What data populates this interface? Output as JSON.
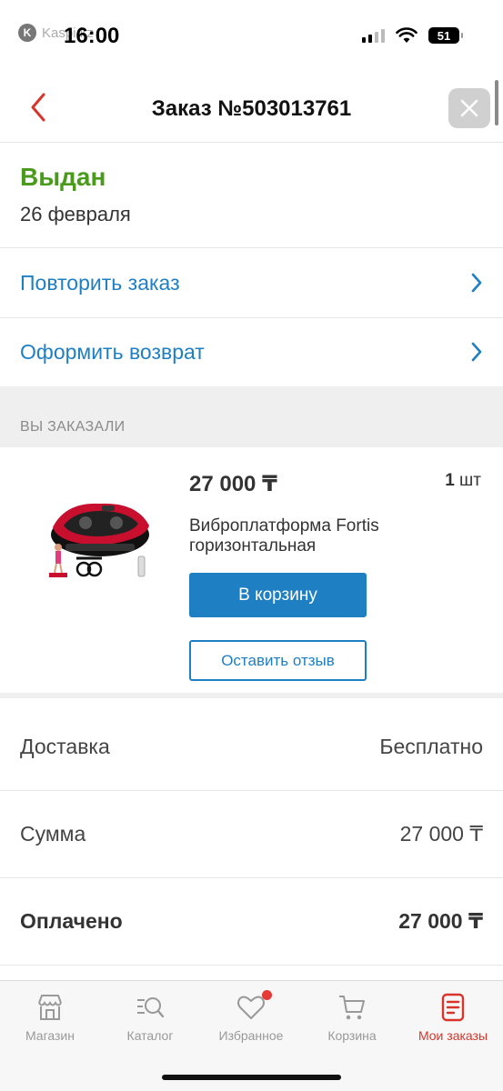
{
  "status_bar": {
    "app_name": "Kaspi.kz",
    "time": "16:00",
    "battery": "51"
  },
  "header": {
    "title": "Заказ №503013761"
  },
  "order": {
    "status": "Выдан",
    "date": "26 февраля",
    "status_color": "#4a9a1c"
  },
  "actions": [
    {
      "label": "Повторить заказ"
    },
    {
      "label": "Оформить возврат"
    }
  ],
  "section_title": "ВЫ ЗАКАЗАЛИ",
  "product": {
    "price": "27 000 ₸",
    "quantity": "1",
    "quantity_unit": "шт",
    "name": "Виброплатформа Fortis горизонтальная",
    "cart_button": "В корзину",
    "review_button": "Оставить отзыв"
  },
  "totals": [
    {
      "label": "Доставка",
      "value": "Бесплатно"
    },
    {
      "label": "Сумма",
      "value": "27 000 ₸"
    },
    {
      "label": "Оплачено",
      "value": "27 000 ₸"
    }
  ],
  "tab_bar": {
    "tabs": [
      {
        "label": "Магазин",
        "icon": "store-icon"
      },
      {
        "label": "Каталог",
        "icon": "catalog-search-icon"
      },
      {
        "label": "Избранное",
        "icon": "heart-icon"
      },
      {
        "label": "Корзина",
        "icon": "cart-icon"
      },
      {
        "label": "Мои заказы",
        "icon": "orders-icon"
      }
    ],
    "active_color": "#d9342b",
    "accent_color": "#1f7fc3"
  }
}
